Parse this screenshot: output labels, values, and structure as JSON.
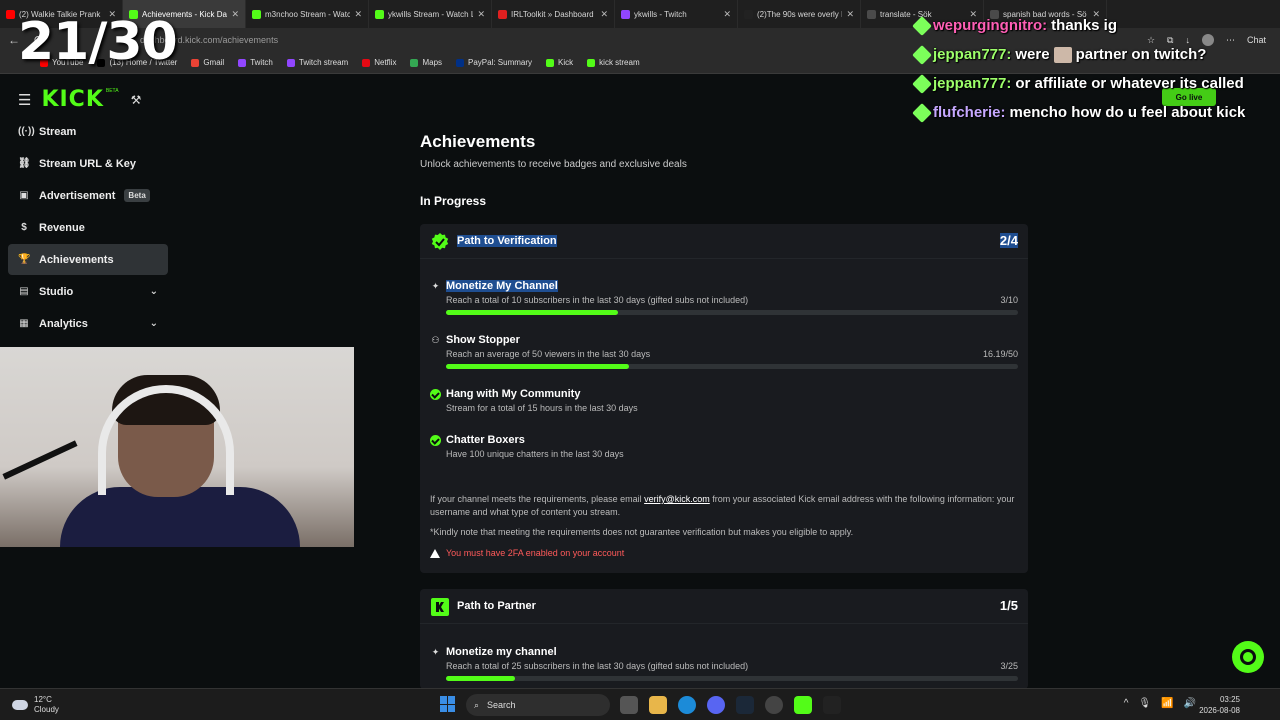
{
  "overlay": {
    "counter": "21/30"
  },
  "browser": {
    "tabs": [
      {
        "title": "(2) Walkie Talkie Prank",
        "color": "#ff0000"
      },
      {
        "title": "Achievements - Kick Da",
        "color": "#53fc18",
        "active": true
      },
      {
        "title": "m3nchoo Stream - Watc",
        "color": "#53fc18"
      },
      {
        "title": "ykwills Stream - Watch L",
        "color": "#53fc18"
      },
      {
        "title": "IRLToolkit » Dashboard",
        "color": "#e02020"
      },
      {
        "title": "ykwills - Twitch",
        "color": "#9146ff"
      },
      {
        "title": "(2)The 90s were overly I",
        "color": "#222222"
      },
      {
        "title": "translate - Sök",
        "color": "#4a4a4a"
      },
      {
        "title": "spanish bad words - Sö",
        "color": "#4a4a4a"
      }
    ],
    "url": "dashboard.kick.com/achievements",
    "chat_label": "Chat",
    "bookmarks": [
      {
        "label": "YouTube",
        "color": "#ff0000"
      },
      {
        "label": "(13) Home / Twitter",
        "color": "#000000"
      },
      {
        "label": "Gmail",
        "color": "#ea4335"
      },
      {
        "label": "Twitch",
        "color": "#9146ff"
      },
      {
        "label": "Twitch stream",
        "color": "#9146ff"
      },
      {
        "label": "Netflix",
        "color": "#e50914"
      },
      {
        "label": "Maps",
        "color": "#34a853"
      },
      {
        "label": "PayPal: Summary",
        "color": "#003087"
      },
      {
        "label": "Kick",
        "color": "#53fc18"
      },
      {
        "label": "kick stream",
        "color": "#53fc18"
      }
    ]
  },
  "brand": {
    "logo": "KICK",
    "beta": "BETA"
  },
  "sidebar": {
    "items": [
      {
        "label": "Stream",
        "icon": "broadcast-icon"
      },
      {
        "label": "Stream URL & Key",
        "icon": "link-icon"
      },
      {
        "label": "Advertisement",
        "icon": "ad-icon",
        "badge": "Beta"
      },
      {
        "label": "Revenue",
        "icon": "dollar-icon"
      },
      {
        "label": "Achievements",
        "icon": "trophy-icon",
        "active": true
      },
      {
        "label": "Studio",
        "icon": "studio-icon",
        "expandable": true
      },
      {
        "label": "Analytics",
        "icon": "analytics-icon",
        "expandable": true
      }
    ]
  },
  "page": {
    "title": "Achievements",
    "subtitle": "Unlock achievements to receive badges and exclusive deals",
    "section": "In Progress"
  },
  "verification": {
    "title": "Path to Verification",
    "count": "2/4",
    "tasks": [
      {
        "name": "Monetize My Channel",
        "desc": "Reach a total of 10 subscribers in the last 30 days (gifted subs not included)",
        "progress_text": "3/10",
        "progress": 0.3
      },
      {
        "name": "Show Stopper",
        "desc": "Reach an average of 50 viewers in the last 30 days",
        "progress_text": "16.19/50",
        "progress": 0.32
      },
      {
        "name": "Hang with My Community",
        "desc": "Stream for a total of 15 hours in the last 30 days",
        "done": true
      },
      {
        "name": "Chatter Boxers",
        "desc": "Have 100 unique chatters in the last 30 days",
        "done": true
      }
    ],
    "note_pre": "If your channel meets the requirements, please email ",
    "note_email": "verify@kick.com",
    "note_post": " from your associated Kick email address with the following information: your username and what type of content you stream.",
    "disclaimer": "*Kindly note that meeting the requirements does not guarantee verification but makes you eligible to apply.",
    "warning": "You must have 2FA enabled on your account"
  },
  "partner": {
    "title": "Path to Partner",
    "count": "1/5",
    "task": {
      "name": "Monetize my channel",
      "desc": "Reach a total of 25 subscribers in the last 30 days (gifted subs not included)",
      "progress_text": "3/25",
      "progress": 0.12
    }
  },
  "chat": [
    {
      "user": "wepurgingnitro",
      "msg": "thanks ig",
      "color": "pink"
    },
    {
      "user": "jeppan777",
      "msg": "were",
      "msg2": "partner on twitch?",
      "emote": true
    },
    {
      "user": "jeppan777",
      "msg": "or affiliate or whatever its called"
    },
    {
      "user": "flufcherie",
      "msg": "mencho how do u feel about kick",
      "color": "vio"
    }
  ],
  "golive": "Go live",
  "taskbar": {
    "temp": "12°C",
    "weather": "Cloudy",
    "search": "Search",
    "time": "03:25",
    "date": "2026-08-08"
  }
}
